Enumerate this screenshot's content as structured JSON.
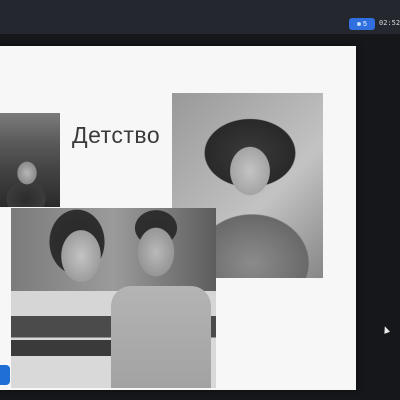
{
  "topbar": {
    "badge_count": "5",
    "clock": "02:52"
  },
  "slide": {
    "title": "Детство"
  },
  "photos": [
    {
      "name": "photo-winter-child"
    },
    {
      "name": "photo-boy"
    },
    {
      "name": "photo-couple"
    }
  ],
  "colors": {
    "accent": "#2f6fe0",
    "slide_bg": "#f7f7f8",
    "title_text": "#3b3b3d"
  }
}
